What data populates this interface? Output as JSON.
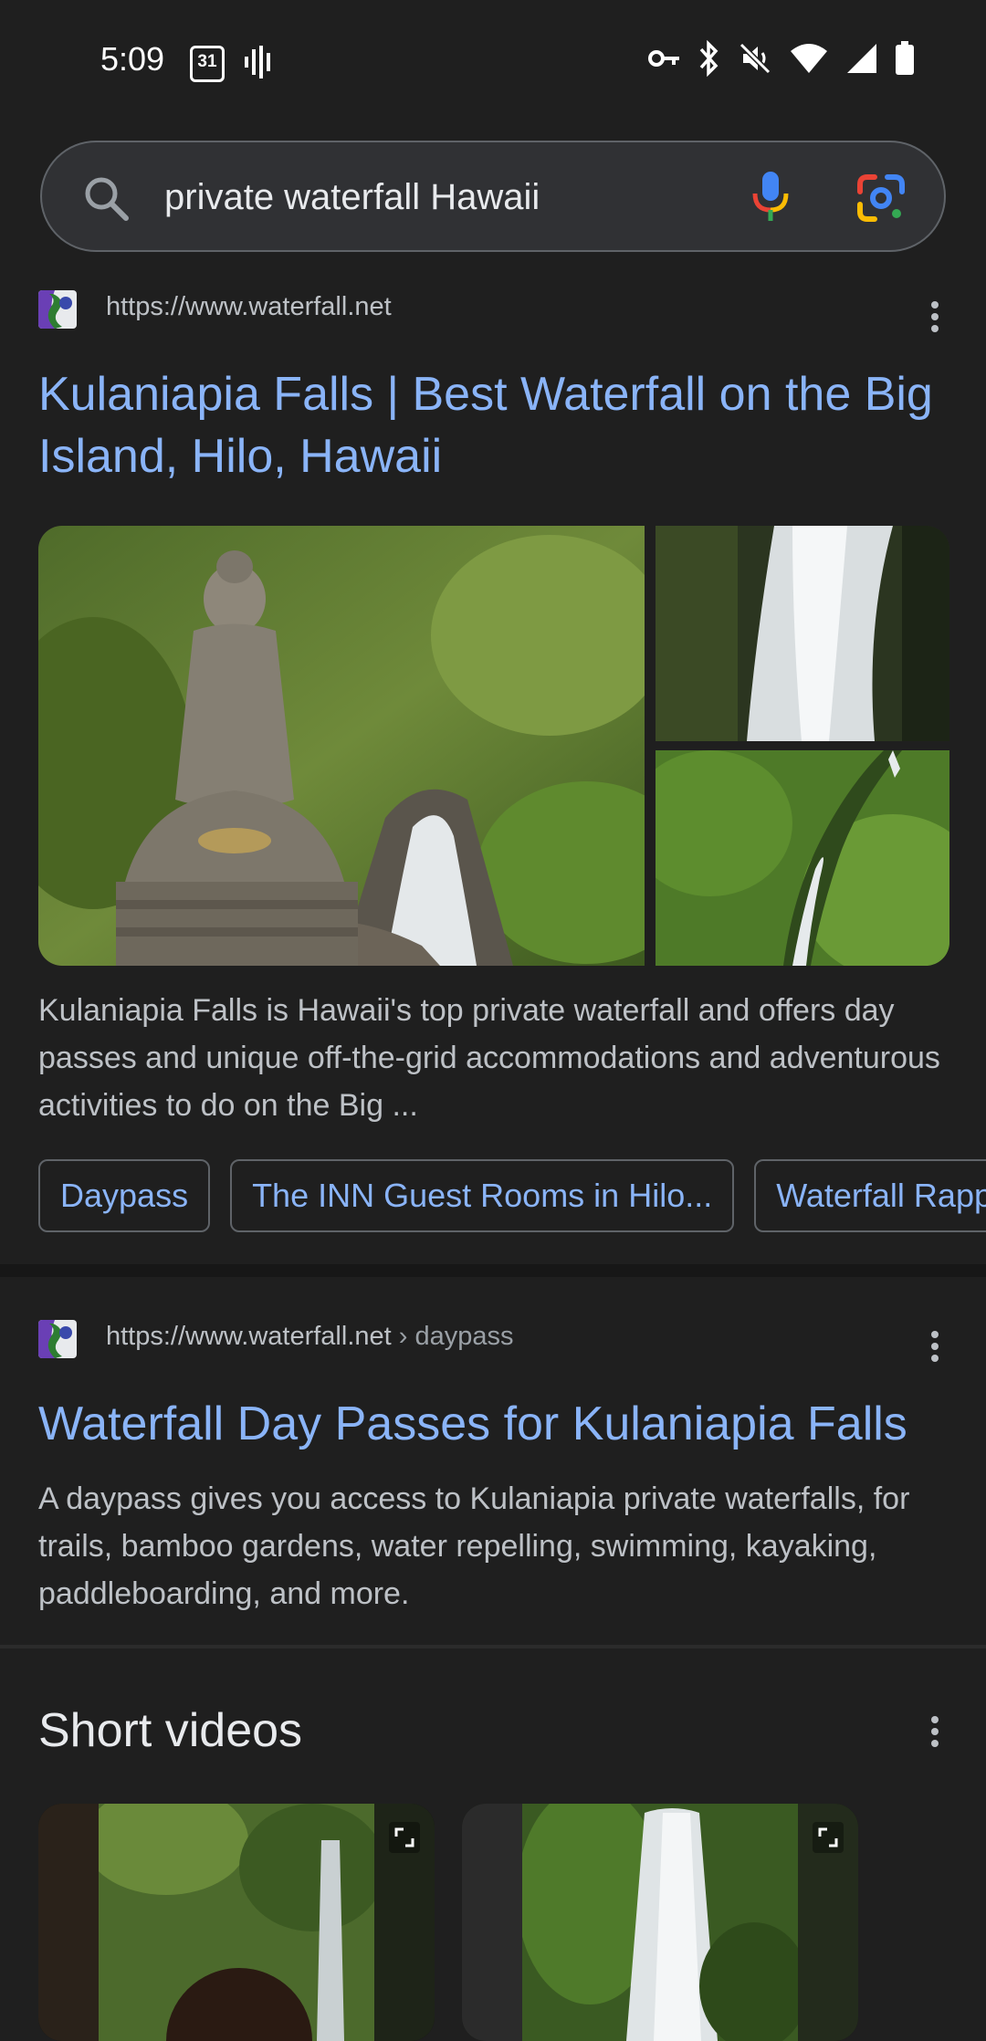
{
  "status_bar": {
    "time": "5:09",
    "calendar_day": "31",
    "icons": [
      "calendar-icon",
      "voice-icon",
      "key-icon",
      "bluetooth-icon",
      "mute-icon",
      "wifi-icon",
      "signal-icon",
      "battery-icon"
    ]
  },
  "search": {
    "query": "private waterfall Hawaii"
  },
  "results": [
    {
      "url": "https://www.waterfall.net",
      "title": "Kulaniapia Falls | Best Waterfall on the Big Island, Hilo, Hawaii",
      "snippet": "Kulaniapia Falls is Hawaii's top private waterfall and offers day passes and unique off-the-grid accommodations and adventurous activities to do on the Big ...",
      "chips": [
        "Daypass",
        "The INN Guest Rooms in Hilo...",
        "Waterfall Rapp"
      ]
    },
    {
      "url": "https://www.waterfall.net",
      "breadcrumb": " › daypass",
      "title": "Waterfall Day Passes for Kulaniapia Falls",
      "snippet": "A daypass gives you access to Kulaniapia private waterfalls, for trails, bamboo gardens, water repelling, swimming, kayaking, paddleboarding, and more."
    }
  ],
  "short_videos": {
    "title": "Short videos"
  },
  "colors": {
    "background": "#1f1f1f",
    "link": "#8ab4f8",
    "text": "#bdc1c6"
  }
}
